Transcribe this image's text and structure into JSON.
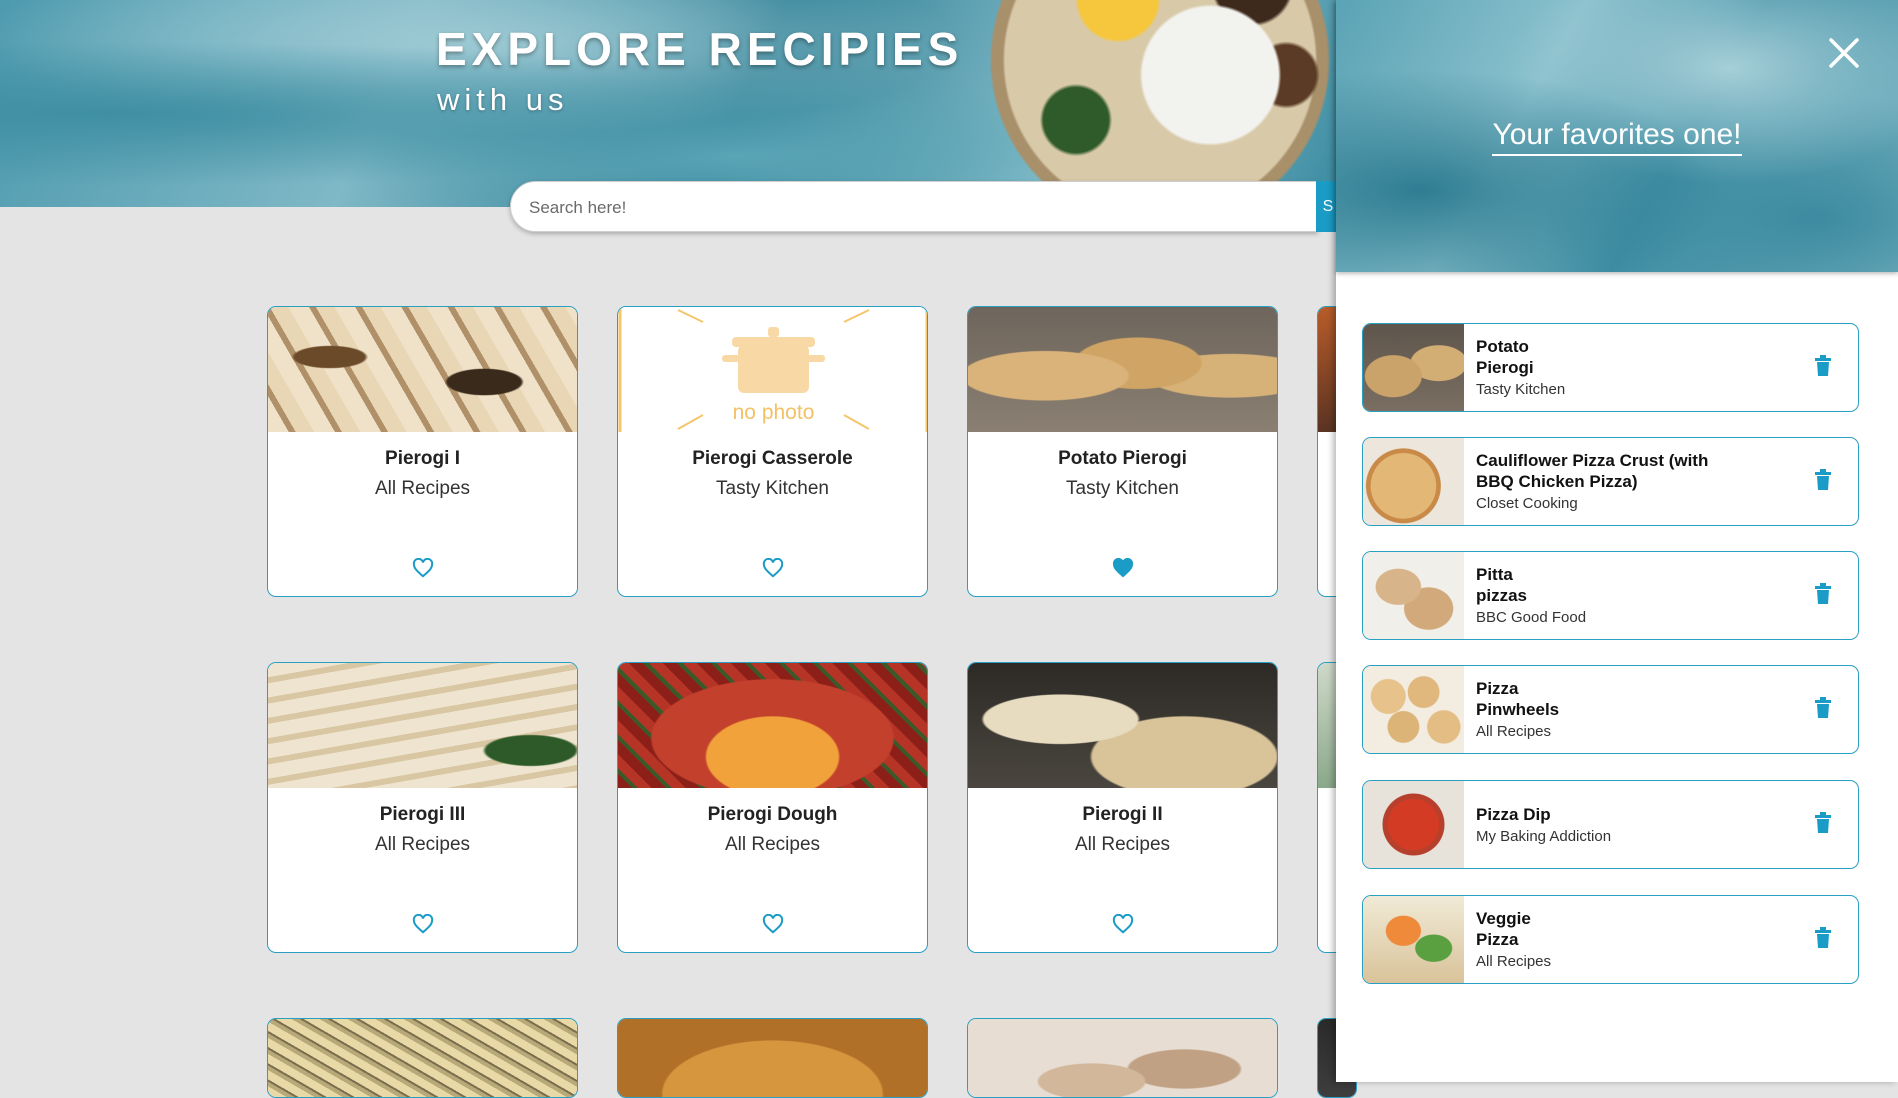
{
  "hero": {
    "title": "EXPLORE RECIPIES",
    "subtitle": "with us"
  },
  "search": {
    "placeholder": "Search here!",
    "button_label": "S"
  },
  "recipes": [
    {
      "title": "Pierogi I",
      "source": "All Recipes",
      "favorite": false,
      "image": "photo"
    },
    {
      "title": "Pierogi Casserole",
      "source": "Tasty Kitchen",
      "favorite": false,
      "image": "no-photo"
    },
    {
      "title": "Potato Pierogi",
      "source": "Tasty Kitchen",
      "favorite": true,
      "image": "photo"
    },
    {
      "title": "Pierogi III",
      "source": "All Recipes",
      "favorite": false,
      "image": "photo"
    },
    {
      "title": "Pierogi Dough",
      "source": "All Recipes",
      "favorite": false,
      "image": "photo"
    },
    {
      "title": "Pierogi II",
      "source": "All Recipes",
      "favorite": false,
      "image": "photo"
    }
  ],
  "no_photo_label": "no photo",
  "favorites_panel": {
    "title": "Your favorites one!",
    "close_icon": "close-icon",
    "items": [
      {
        "title": "Potato\nPierogi",
        "source": "Tasty Kitchen"
      },
      {
        "title": "Cauliflower Pizza Crust (with\nBBQ Chicken Pizza)",
        "source": "Closet Cooking"
      },
      {
        "title": "Pitta\npizzas",
        "source": "BBC Good Food"
      },
      {
        "title": "Pizza\nPinwheels",
        "source": "All Recipes"
      },
      {
        "title": "Pizza Dip",
        "source": "My Baking Addiction"
      },
      {
        "title": "Veggie\nPizza",
        "source": "All Recipes"
      }
    ]
  },
  "colors": {
    "accent": "#1a9cc6",
    "card_border": "#2a9fc4",
    "page_background": "#e4e4e4",
    "no_photo": "#f4c66c"
  }
}
